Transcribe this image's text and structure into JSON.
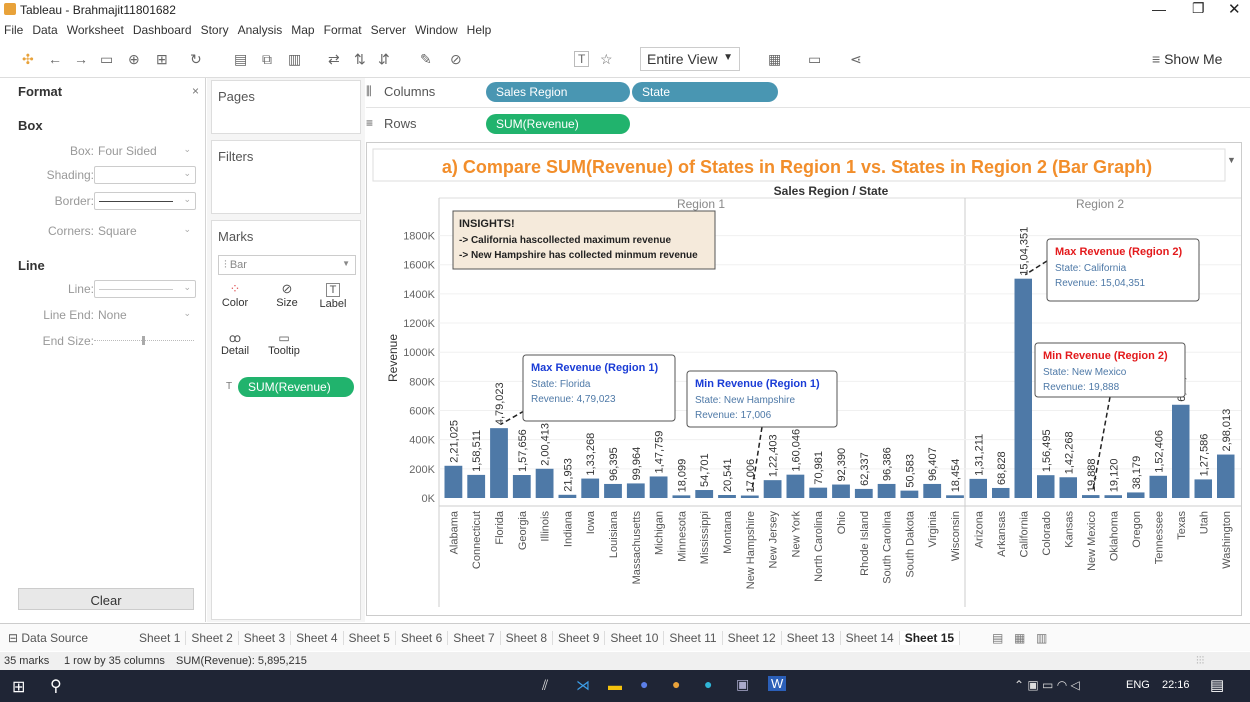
{
  "window": {
    "title": "Tableau - Brahmajit11801682"
  },
  "menu": [
    "File",
    "Data",
    "Worksheet",
    "Dashboard",
    "Story",
    "Analysis",
    "Map",
    "Format",
    "Server",
    "Window",
    "Help"
  ],
  "toolbar": {
    "view_mode": "Entire View",
    "show_me": "Show Me"
  },
  "format_pane": {
    "title": "Format",
    "close": "×",
    "section_box": "Box",
    "box_label": "Box:",
    "box_value": "Four Sided",
    "shading_label": "Shading:",
    "border_label": "Border:",
    "corners_label": "Corners:",
    "corners_value": "Square",
    "section_line": "Line",
    "line_label": "Line:",
    "line_end_label": "Line End:",
    "line_end_value": "None",
    "end_size_label": "End Size:",
    "clear_button": "Clear"
  },
  "cards": {
    "pages": "Pages",
    "filters": "Filters",
    "marks": "Marks",
    "mark_type": "Bar",
    "color": "Color",
    "size": "Size",
    "label": "Label",
    "detail": "Detail",
    "tooltip": "Tooltip",
    "measure_pill": "SUM(Revenue)"
  },
  "shelves": {
    "columns_label": "Columns",
    "rows_label": "Rows",
    "columns": [
      "Sales Region",
      "State"
    ],
    "rows": [
      "SUM(Revenue)"
    ]
  },
  "colors": {
    "bar": "#4e79a7",
    "pill": "#4996b2",
    "green_pill": "#21b36d",
    "title": "#f28e2b",
    "max": "#e31a1c",
    "min": "#1a3cd6",
    "note_bg": "#f5eadb"
  },
  "chart_data": {
    "type": "bar",
    "title": "a) Compare SUM(Revenue) of States in Region 1 vs. States in Region 2 (Bar Graph)",
    "header": "Sales Region / State",
    "ylabel": "Revenue",
    "yticks": [
      "0K",
      "200K",
      "400K",
      "600K",
      "800K",
      "1000K",
      "1200K",
      "1400K",
      "1600K",
      "1800K"
    ],
    "ylim": [
      0,
      1900000
    ],
    "regions": [
      {
        "name": "Region 1",
        "states": [
          "Alabama",
          "Connecticut",
          "Florida",
          "Georgia",
          "Illinois",
          "Indiana",
          "Iowa",
          "Louisiana",
          "Massachusetts",
          "Michigan",
          "Minnesota",
          "Mississippi",
          "Montana",
          "New Hampshire",
          "New Jersey",
          "New York",
          "North Carolina",
          "Ohio",
          "Rhode Island",
          "South Carolina",
          "South Dakota",
          "Virginia",
          "Wisconsin"
        ],
        "values": [
          221025,
          158511,
          479023,
          157656,
          200413,
          21953,
          133268,
          96395,
          99964,
          147759,
          18099,
          54701,
          20541,
          17006,
          122403,
          160046,
          70981,
          92390,
          62337,
          96386,
          50583,
          96407,
          18454
        ],
        "labels": [
          "2,21,025",
          "1,58,511",
          "4,79,023",
          "1,57,656",
          "2,00,413",
          "21,953",
          "1,33,268",
          "96,395",
          "99,964",
          "1,47,759",
          "18,099",
          "54,701",
          "20,541",
          "17,006",
          "1,22,403",
          "1,60,046",
          "70,981",
          "92,390",
          "62,337",
          "96,386",
          "50,583",
          "96,407",
          "18,454"
        ]
      },
      {
        "name": "Region 2",
        "states": [
          "Arizona",
          "Arkansas",
          "California",
          "Colorado",
          "Kansas",
          "New Mexico",
          "Oklahoma",
          "Oregon",
          "Tennessee",
          "Texas",
          "Utah",
          "Washington"
        ],
        "values": [
          131211,
          68828,
          1504351,
          156495,
          142268,
          19888,
          19120,
          38179,
          152406,
          639563,
          127586,
          298013
        ],
        "labels": [
          "1,31,211",
          "68,828",
          "15,04,351",
          "1,56,495",
          "1,42,268",
          "19,888",
          "19,120",
          "38,179",
          "1,52,406",
          "6,39,563",
          "1,27,586",
          "2,98,013"
        ]
      }
    ],
    "insights": {
      "title": "INSIGHTS!",
      "lines": [
        "-> California hascollected maximum revenue",
        "-> New Hampshire has collected minmum revenue"
      ]
    },
    "annotations": [
      {
        "title": "Max Revenue (Region 1)",
        "state": "State: Florida",
        "revenue": "Revenue: 4,79,023",
        "kind": "max-blue"
      },
      {
        "title": "Min Revenue (Region 1)",
        "state": "State: New Hampshire",
        "revenue": "Revenue: 17,006",
        "kind": "min-blue"
      },
      {
        "title": "Max Revenue (Region 2)",
        "state": "State: California",
        "revenue": "Revenue: 15,04,351",
        "kind": "max-red"
      },
      {
        "title": "Min Revenue (Region 2)",
        "state": "State: New Mexico",
        "revenue": "Revenue: 19,888",
        "kind": "min-red"
      }
    ]
  },
  "sheet_tabs": {
    "data_source": "Data Source",
    "sheets": [
      "Sheet 1",
      "Sheet 2",
      "Sheet 3",
      "Sheet 4",
      "Sheet 5",
      "Sheet 6",
      "Sheet 7",
      "Sheet 8",
      "Sheet 9",
      "Sheet 10",
      "Sheet 11",
      "Sheet 12",
      "Sheet 13",
      "Sheet 14",
      "Sheet 15"
    ],
    "active": "Sheet 15"
  },
  "status": {
    "marks": "35 marks",
    "layout": "1 row by 35 columns",
    "sum": "SUM(Revenue): 5,895,215"
  },
  "taskbar": {
    "lang": "ENG",
    "time": "22:16"
  }
}
